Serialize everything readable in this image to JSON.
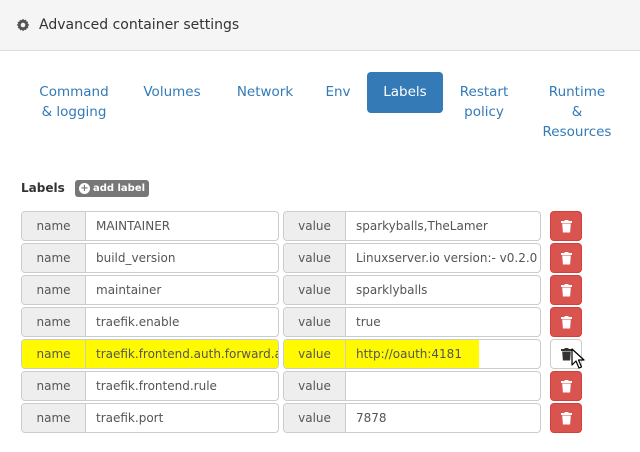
{
  "panel": {
    "title": "Advanced container settings",
    "icon": "gear-icon"
  },
  "tabs": [
    {
      "label": "Command\n& logging",
      "active": false
    },
    {
      "label": "Volumes",
      "active": false
    },
    {
      "label": "Network",
      "active": false
    },
    {
      "label": "Env",
      "active": false
    },
    {
      "label": "Labels",
      "active": true
    },
    {
      "label": "Restart\npolicy",
      "active": false
    },
    {
      "label": "Runtime\n&\nResources",
      "active": false
    }
  ],
  "labels_section": {
    "heading": "Labels",
    "add_label": "add label"
  },
  "addon_labels": {
    "name": "name",
    "value": "value"
  },
  "rows": [
    {
      "name": "MAINTAINER",
      "value": "sparkyballs,TheLamer"
    },
    {
      "name": "build_version",
      "value": "Linuxserver.io version:- v0.2.0"
    },
    {
      "name": "maintainer",
      "value": "sparklyballs"
    },
    {
      "name": "traefik.enable",
      "value": "true"
    },
    {
      "name": "traefik.frontend.auth.forward.address",
      "value": "http://oauth:4181"
    },
    {
      "name": "traefik.frontend.rule",
      "value": ""
    },
    {
      "name": "traefik.port",
      "value": "7878"
    }
  ],
  "colors": {
    "primary": "#337ab7",
    "danger": "#d9534f",
    "highlight": "#fffa00",
    "addon_bg": "#eeeeee",
    "badge": "#777777"
  }
}
